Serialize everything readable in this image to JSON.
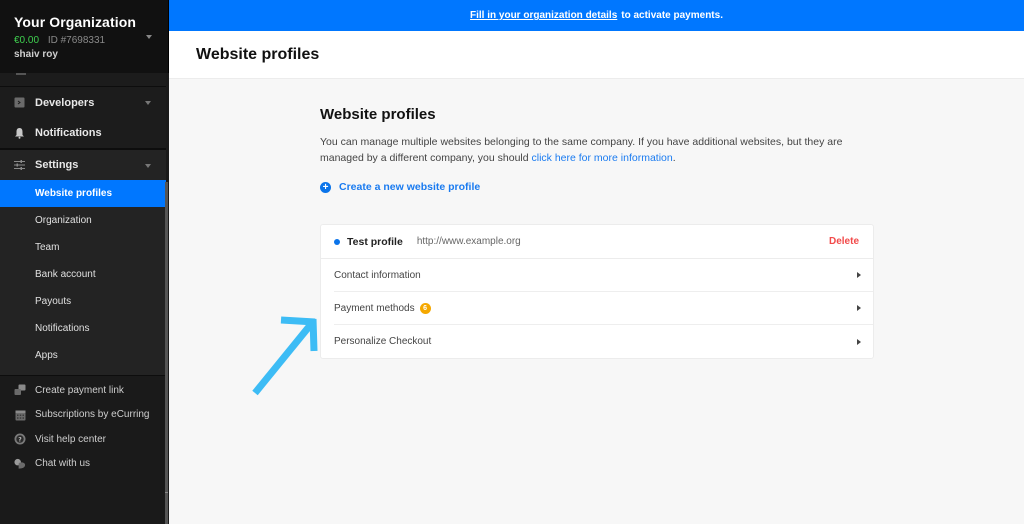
{
  "sidebar": {
    "org": {
      "name": "Your Organization",
      "balance": "€0.00",
      "id_label": "ID #7698331",
      "user": "shaiv roy"
    },
    "sections": [
      {
        "label": "Developers",
        "icon": "code-icon",
        "expandable": true
      },
      {
        "label": "Notifications",
        "icon": "bell-icon",
        "expandable": false
      },
      {
        "label": "Settings",
        "icon": "sliders-icon",
        "expandable": true
      }
    ],
    "settings_items": [
      {
        "label": "Website profiles",
        "active": true
      },
      {
        "label": "Organization",
        "active": false
      },
      {
        "label": "Team",
        "active": false
      },
      {
        "label": "Bank account",
        "active": false
      },
      {
        "label": "Payouts",
        "active": false
      },
      {
        "label": "Notifications",
        "active": false
      },
      {
        "label": "Apps",
        "active": false
      }
    ],
    "bottom_items": [
      {
        "label": "Create payment link",
        "icon": "payment-link-icon"
      },
      {
        "label": "Subscriptions by eCurring",
        "icon": "calendar-icon"
      },
      {
        "label": "Visit help center",
        "icon": "help-icon"
      },
      {
        "label": "Chat with us",
        "icon": "chat-icon"
      }
    ],
    "ghost_item": "Chat with us"
  },
  "banner": {
    "link_text": "Fill in your organization details",
    "rest_text": "to activate payments."
  },
  "header": {
    "title": "Website profiles"
  },
  "main": {
    "title": "Website profiles",
    "desc_before": "You can manage multiple websites belonging to the same company. If you have additional websites, but they are managed by a different company, you should ",
    "desc_link": "click here for more information",
    "desc_after": ".",
    "create_label": "Create a new website profile",
    "profile": {
      "name": "Test profile",
      "url": "http://www.example.org",
      "delete_label": "Delete",
      "rows": [
        {
          "label": "Contact information"
        },
        {
          "label": "Payment methods",
          "badge": "6"
        },
        {
          "label": "Personalize Checkout"
        }
      ]
    }
  },
  "colors": {
    "accent": "#0077ff",
    "sidebar_bg": "#1a1a1a",
    "danger": "#f24a4a",
    "badge": "#f5a800",
    "balance": "#3fcf4f",
    "annotation": "#3dbcf5"
  }
}
